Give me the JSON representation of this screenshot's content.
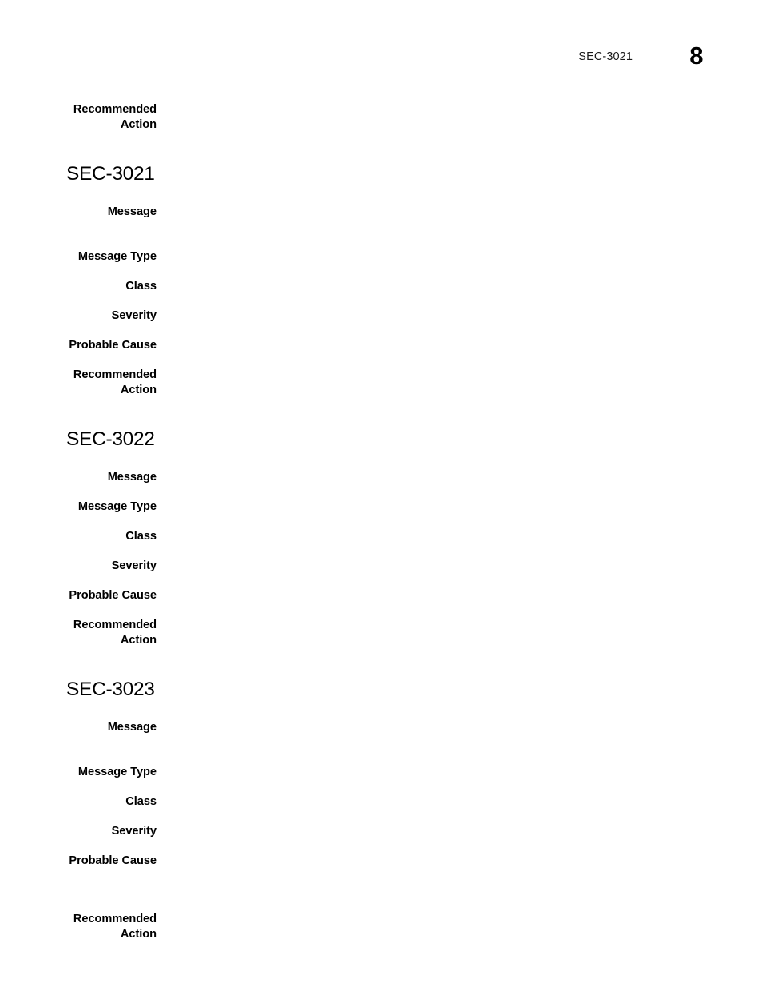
{
  "document": {
    "header": {
      "reference": "SEC-3021",
      "page_number": "8"
    },
    "continued_block": {
      "label_line1": "Recommended",
      "label_line2": "Action"
    },
    "labels": {
      "message": "Message",
      "message_type": "Message Type",
      "class": "Class",
      "severity": "Severity",
      "probable_cause": "Probable Cause",
      "recommended_action_line1": "Recommended",
      "recommended_action_line2": "Action"
    },
    "sections": [
      {
        "heading": "SEC-3021",
        "fields": [
          {
            "label": "Message",
            "value": ""
          },
          {
            "label": "Message Type",
            "value": ""
          },
          {
            "label": "Class",
            "value": ""
          },
          {
            "label": "Severity",
            "value": ""
          },
          {
            "label": "Probable Cause",
            "value": ""
          },
          {
            "label_line1": "Recommended",
            "label_line2": "Action",
            "value": ""
          }
        ]
      },
      {
        "heading": "SEC-3022",
        "fields": [
          {
            "label": "Message",
            "value": ""
          },
          {
            "label": "Message Type",
            "value": ""
          },
          {
            "label": "Class",
            "value": ""
          },
          {
            "label": "Severity",
            "value": ""
          },
          {
            "label": "Probable Cause",
            "value": ""
          },
          {
            "label_line1": "Recommended",
            "label_line2": "Action",
            "value": ""
          }
        ]
      },
      {
        "heading": "SEC-3023",
        "fields": [
          {
            "label": "Message",
            "value": ""
          },
          {
            "label": "Message Type",
            "value": ""
          },
          {
            "label": "Class",
            "value": ""
          },
          {
            "label": "Severity",
            "value": ""
          },
          {
            "label": "Probable Cause",
            "value": ""
          },
          {
            "label_line1": "Recommended",
            "label_line2": "Action",
            "value": ""
          }
        ]
      }
    ]
  },
  "colors": {
    "page_background": "#ffffff",
    "text": "#000000",
    "header_text": "#1a1a1a"
  }
}
